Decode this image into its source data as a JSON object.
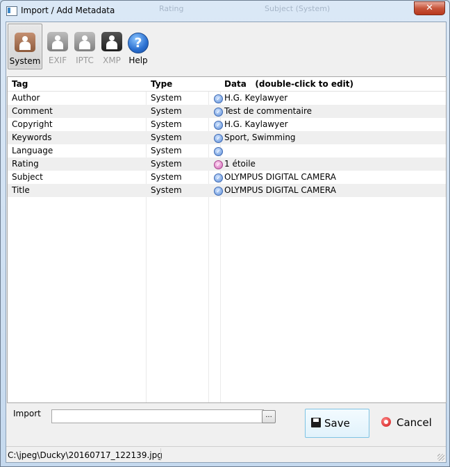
{
  "window": {
    "title": "Import / Add Metadata",
    "close_glyph": "✕",
    "background_ghost": [
      "Rating",
      "Subject (System)"
    ]
  },
  "toolbar": {
    "buttons": [
      {
        "label": "System",
        "icon": "person-icon",
        "state": "selected",
        "color": "#9b6a4a"
      },
      {
        "label": "EXIF",
        "icon": "person-icon",
        "state": "disabled",
        "color": "#8c8c8c"
      },
      {
        "label": "IPTC",
        "icon": "person-icon",
        "state": "disabled",
        "color": "#8c8c8c"
      },
      {
        "label": "XMP",
        "icon": "person-icon",
        "state": "disabled",
        "color": "#3a3a3a"
      },
      {
        "label": "Help",
        "icon": "help-icon",
        "state": "enabled",
        "color": "#2a6fd0"
      }
    ]
  },
  "table": {
    "columns": [
      "Tag",
      "Type",
      "",
      "Data   (double-click to edit)"
    ],
    "rows": [
      {
        "tag": "Author",
        "type": "System",
        "flag": "check-blue",
        "data": "H.G. Keylawyer"
      },
      {
        "tag": "Comment",
        "type": "System",
        "flag": "check-blue",
        "data": "Test de commentaire"
      },
      {
        "tag": "Copyright",
        "type": "System",
        "flag": "check-blue",
        "data": "H.G. Kaylawyer"
      },
      {
        "tag": "Keywords",
        "type": "System",
        "flag": "check-blue",
        "data": "Sport, Swimming"
      },
      {
        "tag": "Language",
        "type": "System",
        "flag": "check-blue",
        "data": ""
      },
      {
        "tag": "Rating",
        "type": "System",
        "flag": "check-pink",
        "data": "1 étoile"
      },
      {
        "tag": "Subject",
        "type": "System",
        "flag": "check-blue",
        "data": "OLYMPUS DIGITAL CAMERA"
      },
      {
        "tag": "Title",
        "type": "System",
        "flag": "check-blue",
        "data": "OLYMPUS DIGITAL CAMERA"
      }
    ]
  },
  "import": {
    "label": "Import",
    "value": "",
    "browse_label": "..."
  },
  "actions": {
    "save_label": "Save",
    "cancel_label": "Cancel"
  },
  "status": {
    "path": "C:\\jpeg\\Ducky\\20160717_122139.jpg"
  }
}
